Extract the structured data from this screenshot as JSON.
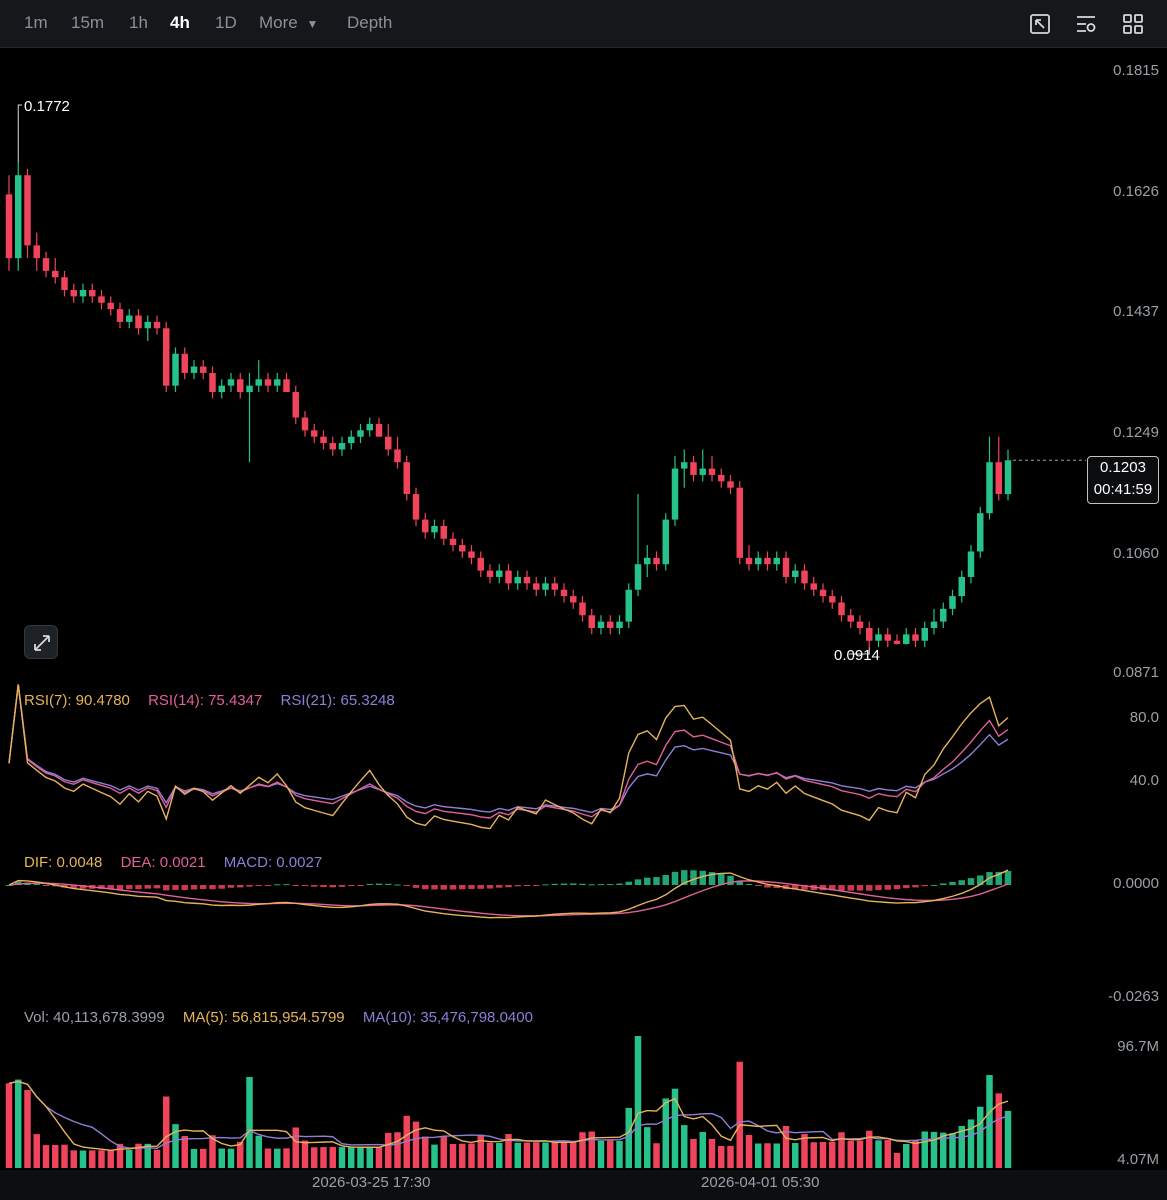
{
  "toolbar": {
    "timeframes": [
      "1m",
      "15m",
      "1h",
      "4h",
      "1D",
      "More",
      "Depth"
    ],
    "active": "4h",
    "tools": [
      "fullscreen-icon",
      "indicator-settings-icon",
      "layout-grid-icon"
    ]
  },
  "colors": {
    "up": "#26c28a",
    "down": "#f0435c",
    "rsi7": "#e6b35a",
    "rsi14": "#e0609a",
    "rsi21": "#8e7fd6",
    "dif": "#e6b35a",
    "dea": "#e0609a",
    "macd": "#8e7fd6",
    "ma5": "#e6b35a",
    "ma10": "#8e7fd6"
  },
  "price_axis": [
    "0.1815",
    "0.1626",
    "0.1437",
    "0.1249",
    "0.1060",
    "0.0871"
  ],
  "last_price": {
    "price": "0.1203",
    "countdown": "00:41:59"
  },
  "high_mark": "0.1772",
  "low_mark": "0.0914",
  "rsi": {
    "rsi7": "RSI(7): 90.4780",
    "rsi14": "RSI(14): 75.4347",
    "rsi21": "RSI(21): 65.3248",
    "axis": [
      "80.0",
      "40.0"
    ]
  },
  "macd": {
    "dif": "DIF: 0.0048",
    "dea": "DEA: 0.0021",
    "macd": "MACD: 0.0027",
    "axis": [
      "0.0000",
      "-0.0263"
    ]
  },
  "volume": {
    "vol": "Vol: 40,113,678.3999",
    "ma5": "MA(5): 56,815,954.5799",
    "ma10": "MA(10): 35,476,798.0400",
    "axis": [
      "96.7M",
      "4.07M"
    ]
  },
  "dates": [
    "2026-03-25 17:30",
    "2026-04-01 05:30"
  ],
  "chart_data": {
    "type": "candlestick",
    "interval": "4h",
    "price_range": [
      0.0871,
      0.1815
    ],
    "candles": [
      [
        0.162,
        0.165,
        0.15,
        0.152
      ],
      [
        0.152,
        0.167,
        0.15,
        0.165
      ],
      [
        0.165,
        0.166,
        0.152,
        0.154
      ],
      [
        0.154,
        0.156,
        0.15,
        0.152
      ],
      [
        0.152,
        0.153,
        0.149,
        0.15
      ],
      [
        0.15,
        0.152,
        0.148,
        0.149
      ],
      [
        0.149,
        0.15,
        0.146,
        0.147
      ],
      [
        0.147,
        0.148,
        0.145,
        0.146
      ],
      [
        0.146,
        0.148,
        0.145,
        0.147
      ],
      [
        0.147,
        0.148,
        0.145,
        0.146
      ],
      [
        0.146,
        0.147,
        0.144,
        0.145
      ],
      [
        0.145,
        0.146,
        0.143,
        0.144
      ],
      [
        0.144,
        0.145,
        0.141,
        0.142
      ],
      [
        0.142,
        0.144,
        0.141,
        0.143
      ],
      [
        0.143,
        0.144,
        0.14,
        0.141
      ],
      [
        0.141,
        0.143,
        0.139,
        0.142
      ],
      [
        0.142,
        0.143,
        0.14,
        0.141
      ],
      [
        0.141,
        0.142,
        0.131,
        0.132
      ],
      [
        0.132,
        0.138,
        0.131,
        0.137
      ],
      [
        0.137,
        0.138,
        0.133,
        0.134
      ],
      [
        0.134,
        0.136,
        0.133,
        0.135
      ],
      [
        0.135,
        0.136,
        0.133,
        0.134
      ],
      [
        0.134,
        0.135,
        0.13,
        0.131
      ],
      [
        0.131,
        0.133,
        0.13,
        0.132
      ],
      [
        0.132,
        0.134,
        0.131,
        0.133
      ],
      [
        0.133,
        0.134,
        0.13,
        0.131
      ],
      [
        0.131,
        0.134,
        0.12,
        0.132
      ],
      [
        0.132,
        0.136,
        0.131,
        0.133
      ],
      [
        0.133,
        0.134,
        0.131,
        0.132
      ],
      [
        0.132,
        0.134,
        0.131,
        0.133
      ],
      [
        0.133,
        0.134,
        0.131,
        0.131
      ],
      [
        0.131,
        0.132,
        0.126,
        0.127
      ],
      [
        0.127,
        0.128,
        0.124,
        0.125
      ],
      [
        0.125,
        0.126,
        0.123,
        0.124
      ],
      [
        0.124,
        0.125,
        0.122,
        0.123
      ],
      [
        0.123,
        0.124,
        0.121,
        0.122
      ],
      [
        0.122,
        0.124,
        0.121,
        0.123
      ],
      [
        0.123,
        0.125,
        0.122,
        0.124
      ],
      [
        0.124,
        0.126,
        0.123,
        0.125
      ],
      [
        0.125,
        0.127,
        0.124,
        0.126
      ],
      [
        0.126,
        0.127,
        0.124,
        0.124
      ],
      [
        0.124,
        0.126,
        0.121,
        0.122
      ],
      [
        0.122,
        0.124,
        0.119,
        0.12
      ],
      [
        0.12,
        0.121,
        0.114,
        0.115
      ],
      [
        0.115,
        0.116,
        0.11,
        0.111
      ],
      [
        0.111,
        0.112,
        0.108,
        0.109
      ],
      [
        0.109,
        0.111,
        0.108,
        0.11
      ],
      [
        0.11,
        0.111,
        0.107,
        0.108
      ],
      [
        0.108,
        0.109,
        0.106,
        0.107
      ],
      [
        0.107,
        0.108,
        0.105,
        0.106
      ],
      [
        0.106,
        0.107,
        0.104,
        0.105
      ],
      [
        0.105,
        0.106,
        0.102,
        0.103
      ],
      [
        0.103,
        0.104,
        0.101,
        0.102
      ],
      [
        0.102,
        0.104,
        0.101,
        0.103
      ],
      [
        0.103,
        0.104,
        0.1,
        0.101
      ],
      [
        0.101,
        0.103,
        0.1,
        0.102
      ],
      [
        0.102,
        0.103,
        0.1,
        0.101
      ],
      [
        0.101,
        0.102,
        0.099,
        0.1
      ],
      [
        0.1,
        0.102,
        0.099,
        0.101
      ],
      [
        0.101,
        0.102,
        0.099,
        0.1
      ],
      [
        0.1,
        0.101,
        0.098,
        0.099
      ],
      [
        0.099,
        0.1,
        0.097,
        0.098
      ],
      [
        0.098,
        0.099,
        0.095,
        0.096
      ],
      [
        0.096,
        0.097,
        0.093,
        0.094
      ],
      [
        0.094,
        0.096,
        0.093,
        0.095
      ],
      [
        0.095,
        0.096,
        0.093,
        0.094
      ],
      [
        0.094,
        0.096,
        0.093,
        0.095
      ],
      [
        0.095,
        0.101,
        0.094,
        0.1
      ],
      [
        0.1,
        0.115,
        0.099,
        0.104
      ],
      [
        0.104,
        0.107,
        0.102,
        0.105
      ],
      [
        0.105,
        0.106,
        0.103,
        0.104
      ],
      [
        0.104,
        0.112,
        0.103,
        0.111
      ],
      [
        0.111,
        0.121,
        0.11,
        0.119
      ],
      [
        0.119,
        0.122,
        0.116,
        0.12
      ],
      [
        0.12,
        0.121,
        0.117,
        0.118
      ],
      [
        0.118,
        0.122,
        0.117,
        0.119
      ],
      [
        0.119,
        0.121,
        0.117,
        0.118
      ],
      [
        0.118,
        0.119,
        0.116,
        0.117
      ],
      [
        0.117,
        0.118,
        0.115,
        0.116
      ],
      [
        0.116,
        0.117,
        0.104,
        0.105
      ],
      [
        0.105,
        0.107,
        0.103,
        0.104
      ],
      [
        0.104,
        0.106,
        0.103,
        0.105
      ],
      [
        0.105,
        0.106,
        0.103,
        0.104
      ],
      [
        0.104,
        0.106,
        0.103,
        0.105
      ],
      [
        0.105,
        0.106,
        0.101,
        0.102
      ],
      [
        0.102,
        0.104,
        0.101,
        0.103
      ],
      [
        0.103,
        0.104,
        0.1,
        0.101
      ],
      [
        0.101,
        0.102,
        0.099,
        0.1
      ],
      [
        0.1,
        0.101,
        0.098,
        0.099
      ],
      [
        0.099,
        0.1,
        0.097,
        0.098
      ],
      [
        0.098,
        0.099,
        0.095,
        0.096
      ],
      [
        0.096,
        0.097,
        0.094,
        0.095
      ],
      [
        0.095,
        0.096,
        0.093,
        0.094
      ],
      [
        0.094,
        0.095,
        0.091,
        0.092
      ],
      [
        0.092,
        0.094,
        0.091,
        0.093
      ],
      [
        0.093,
        0.094,
        0.091,
        0.092
      ],
      [
        0.092,
        0.093,
        0.0914,
        0.0915
      ],
      [
        0.0915,
        0.094,
        0.0914,
        0.093
      ],
      [
        0.093,
        0.094,
        0.091,
        0.092
      ],
      [
        0.092,
        0.095,
        0.091,
        0.094
      ],
      [
        0.094,
        0.097,
        0.093,
        0.095
      ],
      [
        0.095,
        0.098,
        0.094,
        0.097
      ],
      [
        0.097,
        0.1,
        0.096,
        0.099
      ],
      [
        0.099,
        0.103,
        0.098,
        0.102
      ],
      [
        0.102,
        0.107,
        0.101,
        0.106
      ],
      [
        0.106,
        0.113,
        0.105,
        0.112
      ],
      [
        0.112,
        0.124,
        0.111,
        0.12
      ],
      [
        0.12,
        0.124,
        0.114,
        0.115
      ],
      [
        0.115,
        0.122,
        0.114,
        0.1203
      ]
    ]
  }
}
